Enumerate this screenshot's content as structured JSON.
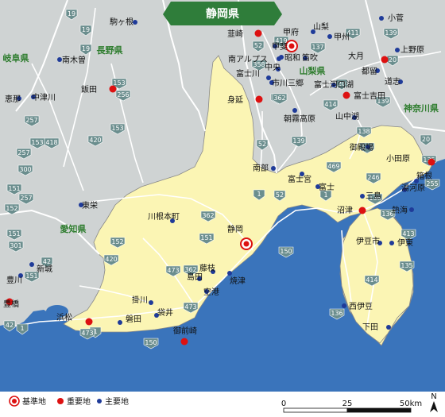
{
  "title": "静岡県",
  "colors": {
    "sea": "#3a74bb",
    "land_other": "#cfd3d3",
    "land_pref": "#fbf5b4",
    "title_bg": "#2f7d3a",
    "base": "#dd1111",
    "important": "#dd1111",
    "main": "#1f3b99",
    "region": "#2f7d2f",
    "route_badge": "#6b8e8e"
  },
  "regions": [
    {
      "name": "長野県"
    },
    {
      "name": "岐阜県"
    },
    {
      "name": "山梨県"
    },
    {
      "name": "愛知県"
    },
    {
      "name": "神奈川県"
    }
  ],
  "cities": [
    {
      "name": "静岡",
      "type": "base"
    },
    {
      "name": "甲府",
      "type": "base"
    },
    {
      "name": "韮崎",
      "type": "important"
    },
    {
      "name": "身延",
      "type": "important"
    },
    {
      "name": "飯田",
      "type": "important"
    },
    {
      "name": "大月",
      "type": "important"
    },
    {
      "name": "富士吉田",
      "type": "important"
    },
    {
      "name": "小田原",
      "type": "important"
    },
    {
      "name": "沼津",
      "type": "important"
    },
    {
      "name": "御前崎",
      "type": "important"
    },
    {
      "name": "浜松",
      "type": "important"
    },
    {
      "name": "豊橋",
      "type": "important"
    },
    {
      "name": "駒ヶ根",
      "type": "main"
    },
    {
      "name": "南木曽",
      "type": "main"
    },
    {
      "name": "中津川",
      "type": "main"
    },
    {
      "name": "恵那",
      "type": "main"
    },
    {
      "name": "山梨",
      "type": "main"
    },
    {
      "name": "甲州",
      "type": "main"
    },
    {
      "name": "小菅",
      "type": "main"
    },
    {
      "name": "甲斐",
      "type": "main"
    },
    {
      "name": "昭和",
      "type": "main"
    },
    {
      "name": "笛吹",
      "type": "main"
    },
    {
      "name": "南アルプス",
      "type": "main"
    },
    {
      "name": "中央",
      "type": "main"
    },
    {
      "name": "富士川",
      "type": "main"
    },
    {
      "name": "市川三郷",
      "type": "main"
    },
    {
      "name": "富士河口湖",
      "type": "main"
    },
    {
      "name": "都留",
      "type": "main"
    },
    {
      "name": "上野原",
      "type": "main"
    },
    {
      "name": "道志",
      "type": "main"
    },
    {
      "name": "山中湖",
      "type": "main"
    },
    {
      "name": "朝霧高原",
      "type": "main"
    },
    {
      "name": "御殿場",
      "type": "main"
    },
    {
      "name": "南部",
      "type": "main"
    },
    {
      "name": "富士宮",
      "type": "main"
    },
    {
      "name": "富士",
      "type": "main"
    },
    {
      "name": "箱根",
      "type": "main"
    },
    {
      "name": "湯河原",
      "type": "main"
    },
    {
      "name": "三島",
      "type": "main"
    },
    {
      "name": "熱海",
      "type": "main"
    },
    {
      "name": "伊豆市",
      "type": "main"
    },
    {
      "name": "伊東",
      "type": "main"
    },
    {
      "name": "西伊豆",
      "type": "main"
    },
    {
      "name": "下田",
      "type": "main"
    },
    {
      "name": "川根本町",
      "type": "main"
    },
    {
      "name": "東栄",
      "type": "main"
    },
    {
      "name": "新城",
      "type": "main"
    },
    {
      "name": "豊川",
      "type": "main"
    },
    {
      "name": "藤枝",
      "type": "main"
    },
    {
      "name": "島田",
      "type": "main"
    },
    {
      "name": "焼津",
      "type": "main"
    },
    {
      "name": "空港",
      "type": "main"
    },
    {
      "name": "掛川",
      "type": "main"
    },
    {
      "name": "袋井",
      "type": "main"
    },
    {
      "name": "磐田",
      "type": "main"
    }
  ],
  "routes": [
    "19",
    "256",
    "153",
    "257",
    "151",
    "152",
    "418",
    "420",
    "473",
    "362",
    "473",
    "1",
    "150",
    "257",
    "42",
    "301",
    "151",
    "52",
    "52",
    "139",
    "139",
    "469",
    "246",
    "1",
    "136",
    "138",
    "413",
    "414",
    "136",
    "135",
    "20",
    "411",
    "137",
    "358",
    "300",
    "20",
    "139",
    "139",
    "20",
    "135",
    "255",
    "1",
    "150",
    "52",
    "419",
    "19",
    "153",
    "19",
    "153",
    "257",
    "151",
    "152",
    "420",
    "42",
    "1",
    "473",
    "362",
    "151",
    "300",
    "362",
    "414",
    "136"
  ],
  "legend": {
    "base": "基準地",
    "important": "重要地",
    "main": "主要地"
  },
  "scale": {
    "ticks": [
      "0",
      "25",
      "50km"
    ]
  },
  "north": "N"
}
